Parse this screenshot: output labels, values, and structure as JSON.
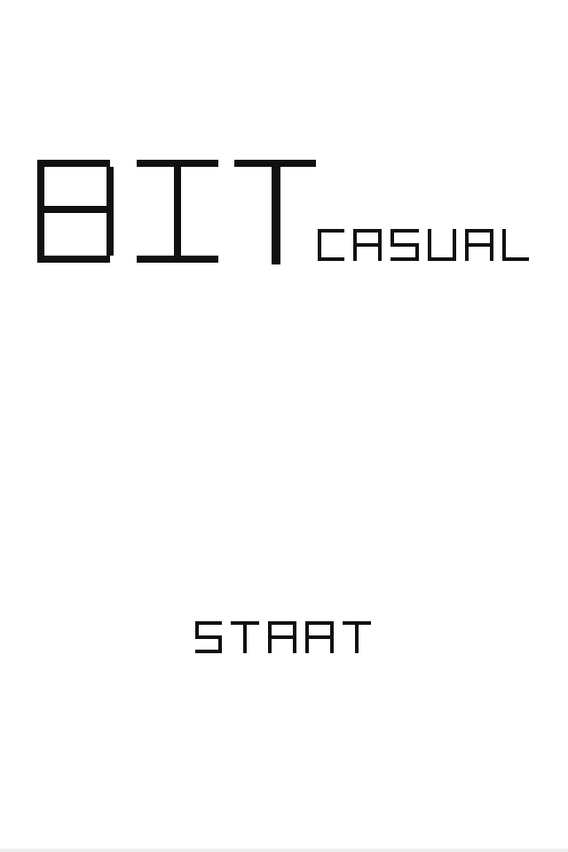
{
  "title": {
    "main": "BIT",
    "sub": "CASUAL"
  },
  "menu": {
    "start_label": "START"
  },
  "colors": {
    "background": "#ffffff",
    "ink": "#111111"
  }
}
